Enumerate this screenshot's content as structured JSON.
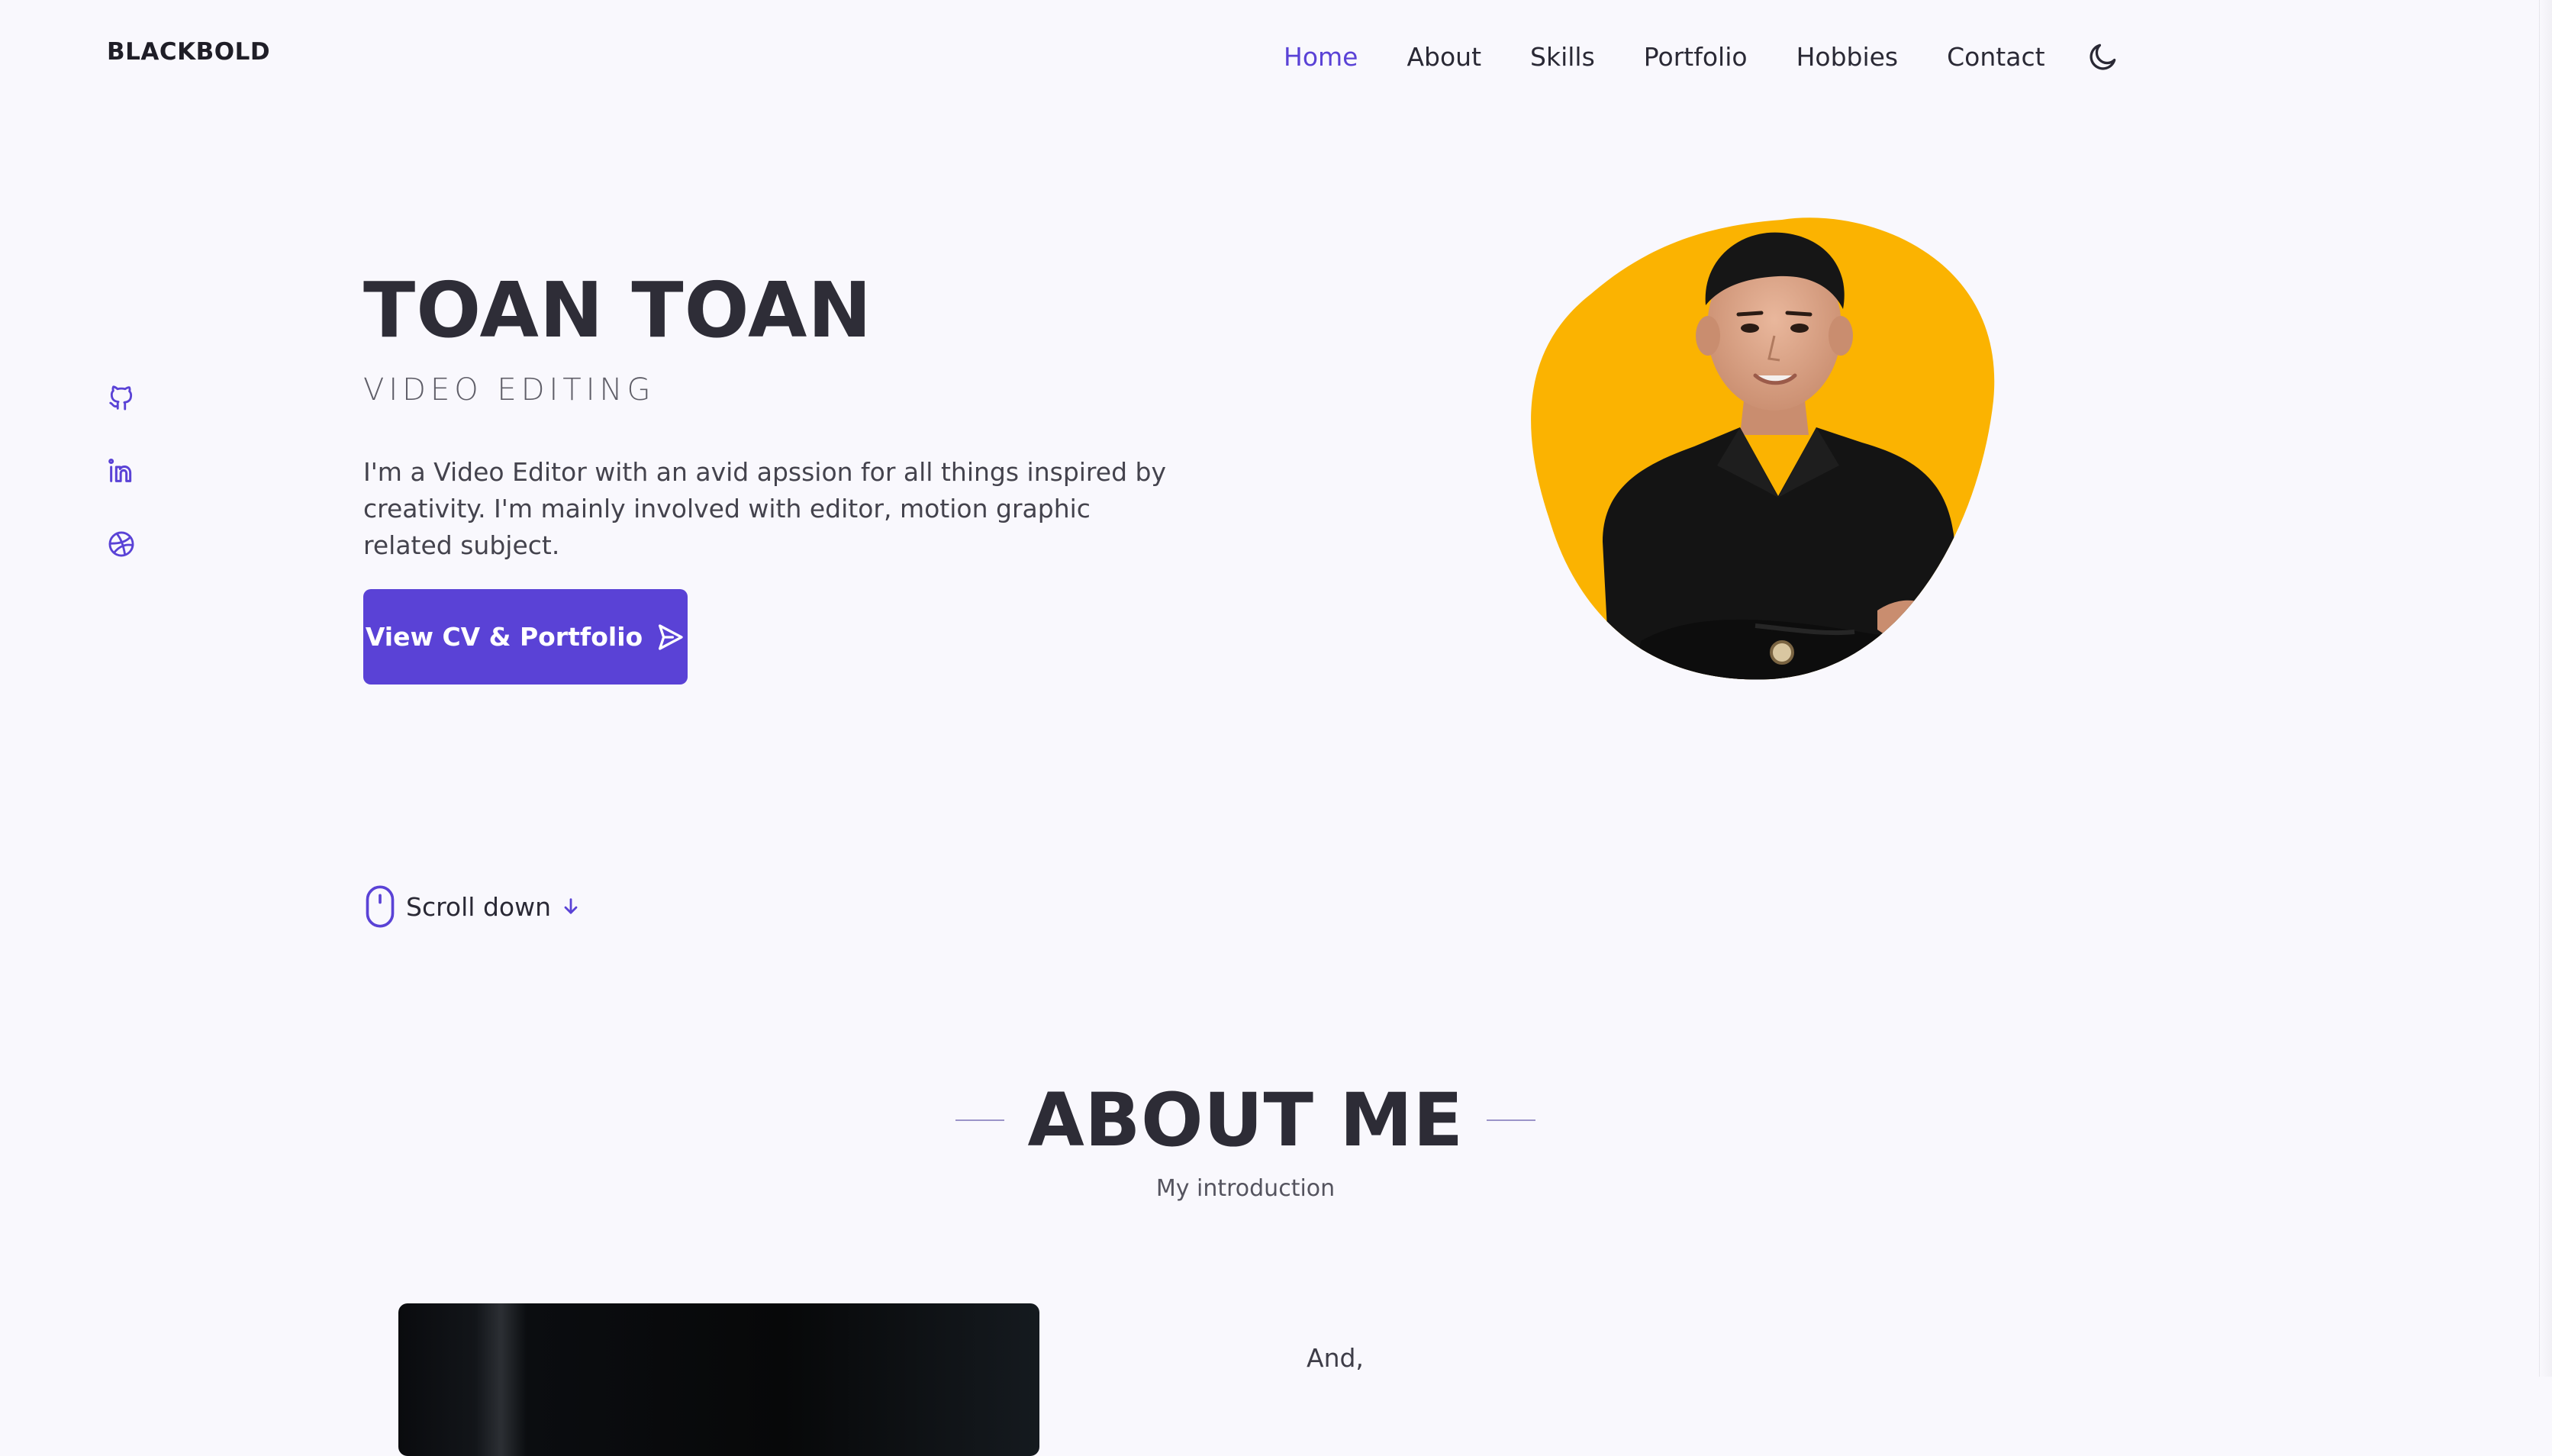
{
  "brand": "BLACKBOLD",
  "nav": {
    "items": [
      {
        "label": "Home",
        "active": true
      },
      {
        "label": "About",
        "active": false
      },
      {
        "label": "Skills",
        "active": false
      },
      {
        "label": "Portfolio",
        "active": false
      },
      {
        "label": "Hobbies",
        "active": false
      },
      {
        "label": "Contact",
        "active": false
      }
    ],
    "theme_icon": "moon-icon"
  },
  "social": [
    {
      "icon": "github-icon"
    },
    {
      "icon": "linkedin-icon"
    },
    {
      "icon": "dribbble-icon"
    }
  ],
  "hero": {
    "name": "TOAN TOAN",
    "role": "VIDEO EDITING",
    "description": "I'm a Video Editor with an avid apssion for all things inspired by creativity. I'm mainly involved with editor, motion graphic related subject.",
    "cta_label": "View CV & Portfolio",
    "cta_icon": "send-icon",
    "portrait_icon": "portrait-image",
    "blob_color": "#fbb301"
  },
  "scroll": {
    "label": "Scroll down",
    "icon": "mouse-icon",
    "arrow_icon": "arrow-down-icon"
  },
  "about": {
    "title": "ABOUT ME",
    "subtitle": "My introduction",
    "text_start": "And,"
  },
  "colors": {
    "accent": "#5a42d6",
    "background": "#f9f8fd",
    "text": "#2b2a35"
  }
}
